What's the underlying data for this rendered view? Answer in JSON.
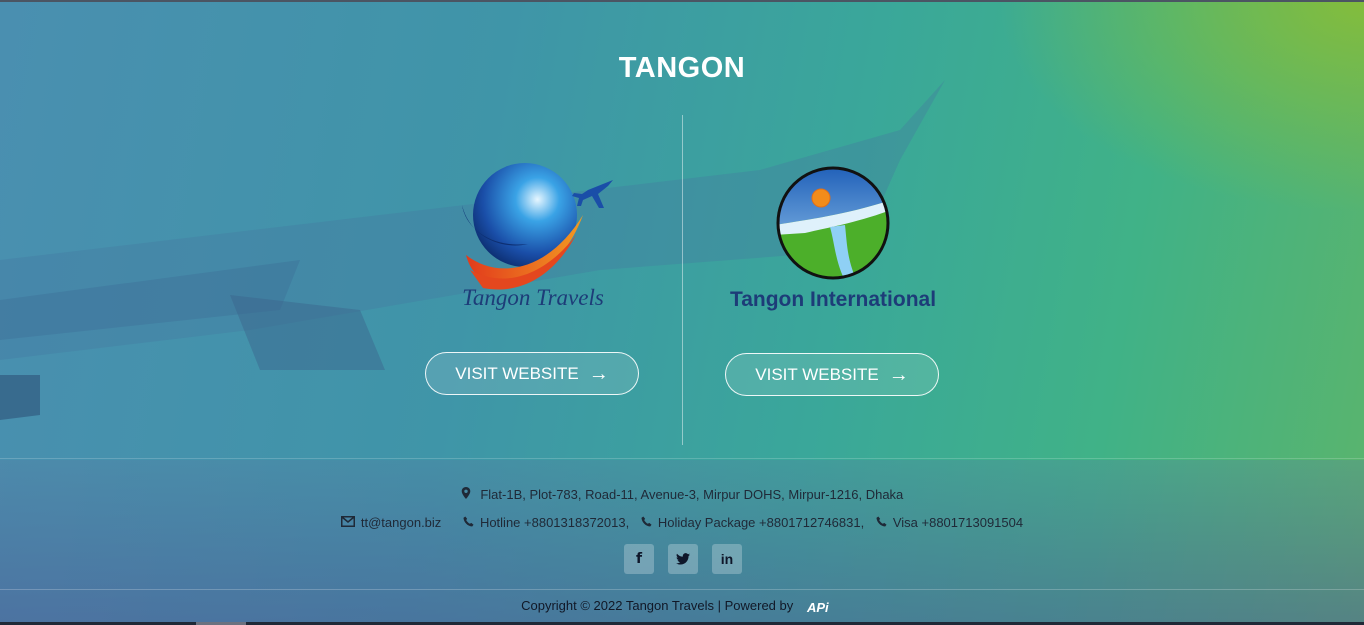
{
  "site": {
    "title": "TANGON"
  },
  "cards": [
    {
      "name": "Tangon Travels",
      "button_label": "VISIT WEBSITE",
      "arrow": "→"
    },
    {
      "name": "Tangon International",
      "button_label": "VISIT WEBSITE",
      "arrow": "→"
    }
  ],
  "footer": {
    "address": "Flat-1B, Plot-783, Road-11, Avenue-3, Mirpur DOHS, Mirpur-1216, Dhaka",
    "email": "tt@tangon.biz",
    "hotline": "Hotline +8801318372013,",
    "holiday": "Holiday Package +8801712746831,",
    "visa": "Visa +8801713091504",
    "social": {
      "facebook": "f",
      "twitter": "t",
      "linkedin": "in"
    },
    "copyright": "Copyright © 2022 Tangon Travels | Powered by",
    "powered_logo": "APi"
  },
  "icons": {
    "location": "map-marker-icon",
    "email": "envelope-icon",
    "phone": "phone-icon"
  },
  "colors": {
    "brand_title": "#ffffff",
    "international_text": "#1d3c78",
    "accent_green": "#5bb46c",
    "accent_blue": "#4a8fb0"
  }
}
